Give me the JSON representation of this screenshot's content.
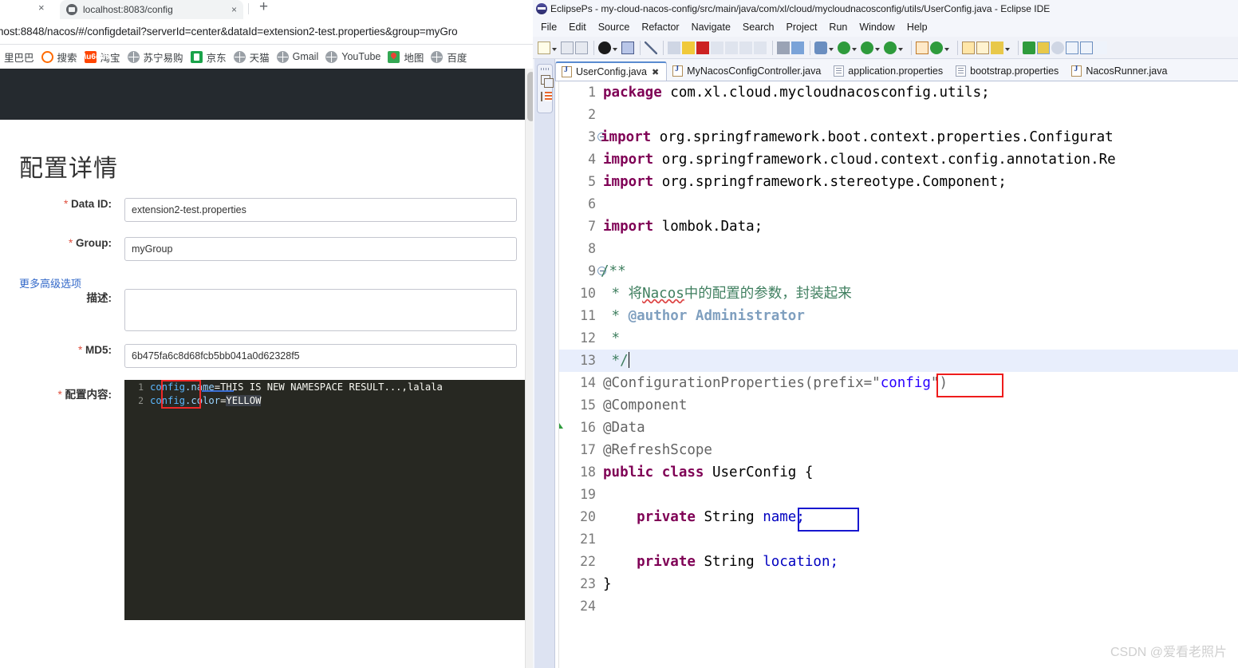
{
  "browser": {
    "tab": {
      "title": "localhost:8083/config",
      "favicon": "globe-icon",
      "close": "×",
      "new_tab": "+",
      "prev_tab_close": "×"
    },
    "url": "host:8848/nacos/#/configdetail?serverId=center&dataId=extension2-test.properties&group=myGro",
    "bookmarks": [
      {
        "label": "里巴巴",
        "icon": "globe-icon"
      },
      {
        "label": "搜索",
        "icon": "search-o-icon"
      },
      {
        "label": "淘宝",
        "icon": "taobao-icon"
      },
      {
        "label": "苏宁易购",
        "icon": "globe-icon"
      },
      {
        "label": "京东",
        "icon": "jd-icon"
      },
      {
        "label": "天猫",
        "icon": "globe-icon"
      },
      {
        "label": "Gmail",
        "icon": "globe-icon"
      },
      {
        "label": "YouTube",
        "icon": "globe-icon"
      },
      {
        "label": "地图",
        "icon": "map-pin-icon"
      },
      {
        "label": "百度",
        "icon": "globe-icon"
      }
    ]
  },
  "nacos": {
    "page_title": "配置详情",
    "advanced_link": "更多高级选项",
    "fields": [
      {
        "label": "Data ID:",
        "required": true,
        "value": "extension2-test.properties"
      },
      {
        "label": "Group:",
        "required": true,
        "value": "myGroup"
      },
      {
        "label": "描述:",
        "required": false,
        "value": ""
      },
      {
        "label": "MD5:",
        "required": true,
        "value": "6b475fa6c8d68fcb5bb041a0d62328f5"
      },
      {
        "label": "配置内容:",
        "required": true,
        "value": ""
      }
    ],
    "editor": {
      "lines": [
        {
          "no": "1",
          "key": "config",
          "dot_prop": ".name",
          "eq": "=",
          "value": "THIS IS NEW NAMESPACE RESULT...,lalala",
          "value_highlight": false
        },
        {
          "no": "2",
          "key": "config",
          "dot_prop": ".color",
          "eq": "=",
          "value": "YELLOW",
          "value_highlight": true
        }
      ]
    }
  },
  "eclipse": {
    "window_title": "EclipsePs - my-cloud-nacos-config/src/main/java/com/xl/cloud/mycloudnacosconfig/utils/UserConfig.java - Eclipse IDE",
    "menu": [
      "File",
      "Edit",
      "Source",
      "Refactor",
      "Navigate",
      "Search",
      "Project",
      "Run",
      "Window",
      "Help"
    ],
    "toolbar_icons": [
      "new-wizard-icon",
      "caret-down-icon",
      "save-icon",
      "save-all-icon",
      "debug-icon",
      "caret-down-icon",
      "open-console-icon",
      "skip-breakpoints-icon",
      "resume-icon",
      "suspend-icon",
      "terminate-icon",
      "step-into-icon",
      "step-over-icon",
      "step-return-icon",
      "drop-to-frame-icon",
      "external-tools-icon",
      "run-last-tool-icon",
      "build-icon",
      "caret-down-icon",
      "run-icon",
      "caret-down-icon",
      "debug-as-icon",
      "caret-down-icon",
      "coverage-icon",
      "caret-down-icon",
      "new-java-project-icon",
      "new-class-icon",
      "caret-down-icon",
      "open-type-icon",
      "open-task-icon",
      "edit-icon",
      "caret-down-icon",
      "java-perspective-icon",
      "pencil-perspective-icon",
      "search-icon",
      "next-annotation-icon",
      "outline-icon",
      "pilcrow-icon"
    ],
    "tabs": [
      {
        "label": "UserConfig.java",
        "icon": "java-file-icon",
        "active": true,
        "closeable": true
      },
      {
        "label": "MyNacosConfigController.java",
        "icon": "java-file-icon",
        "active": false,
        "closeable": false
      },
      {
        "label": "application.properties",
        "icon": "properties-file-icon",
        "active": false,
        "closeable": false
      },
      {
        "label": "bootstrap.properties",
        "icon": "properties-file-icon",
        "active": false,
        "closeable": false
      },
      {
        "label": "NacosRunner.java",
        "icon": "java-file-icon",
        "active": false,
        "closeable": false
      }
    ],
    "code_lines": [
      {
        "no": "1",
        "type": "pkg"
      },
      {
        "no": "2",
        "type": "blank"
      },
      {
        "no": "3",
        "type": "import",
        "fold": true,
        "text": "org.springframework.boot.context.properties.Configurat"
      },
      {
        "no": "4",
        "type": "import",
        "fold": false,
        "text": "org.springframework.cloud.context.config.annotation.Re"
      },
      {
        "no": "5",
        "type": "import",
        "fold": false,
        "text": "org.springframework.stereotype.Component;"
      },
      {
        "no": "6",
        "type": "blank"
      },
      {
        "no": "7",
        "type": "import",
        "fold": false,
        "text": "lombok.Data;"
      },
      {
        "no": "8",
        "type": "blank"
      },
      {
        "no": "9",
        "type": "cmt-open",
        "fold": true
      },
      {
        "no": "10",
        "type": "cmt-cn"
      },
      {
        "no": "11",
        "type": "cmt-author"
      },
      {
        "no": "12",
        "type": "cmt-star"
      },
      {
        "no": "13",
        "type": "cmt-close"
      },
      {
        "no": "14",
        "type": "ann-cfgprops"
      },
      {
        "no": "15",
        "type": "ann",
        "text": "@Component"
      },
      {
        "no": "16",
        "type": "ann",
        "text": "@Data",
        "overview_arrow": true
      },
      {
        "no": "17",
        "type": "ann",
        "text": "@RefreshScope"
      },
      {
        "no": "18",
        "type": "class-decl"
      },
      {
        "no": "19",
        "type": "blank"
      },
      {
        "no": "20",
        "type": "field-name"
      },
      {
        "no": "21",
        "type": "blank"
      },
      {
        "no": "22",
        "type": "field-location"
      },
      {
        "no": "23",
        "type": "brace-close"
      },
      {
        "no": "24",
        "type": "blank"
      }
    ],
    "code_text": {
      "pkg_kw": "package",
      "pkg_name": " com.xl.cloud.mycloudnacosconfig.utils;",
      "import_kw": "import",
      "cmt_open": "/**",
      "cmt_cn_star": " * ",
      "cmt_cn_word": "Nacos",
      "cmt_cn_prefix": "将",
      "cmt_cn_rest": "中的配置的参数，封装起来",
      "cmt_author_star": " * ",
      "cmt_author_tag": "@author",
      "cmt_author_name": " Administrator",
      "cmt_star": " *",
      "cmt_close": " */",
      "ann_cfgprops_pre": "@ConfigurationProperties(prefix=\"",
      "ann_cfgprops_val": "config",
      "ann_cfgprops_post": "\")",
      "class_mod": "public",
      "class_kw": " class",
      "class_name": " UserConfig {",
      "field_mod": "    private",
      "field_type": " String ",
      "field_name_1": "name;",
      "field_name_2": "location;",
      "brace_close": "}"
    },
    "watermark": "CSDN @爱看老照片"
  },
  "colors": {
    "nacos_navbar": "#252a2f",
    "nacos_link": "#3268c9",
    "required_star": "#e0503f",
    "editor_bg": "#272822",
    "eclipse_chrome": "#f4f6fb",
    "highlight_red": "#ee1c1c",
    "highlight_blue": "#1818cf",
    "java_keyword": "#7f0055",
    "java_comment": "#3f7f5f",
    "java_field": "#0000c0",
    "java_string": "#2a00ff"
  }
}
